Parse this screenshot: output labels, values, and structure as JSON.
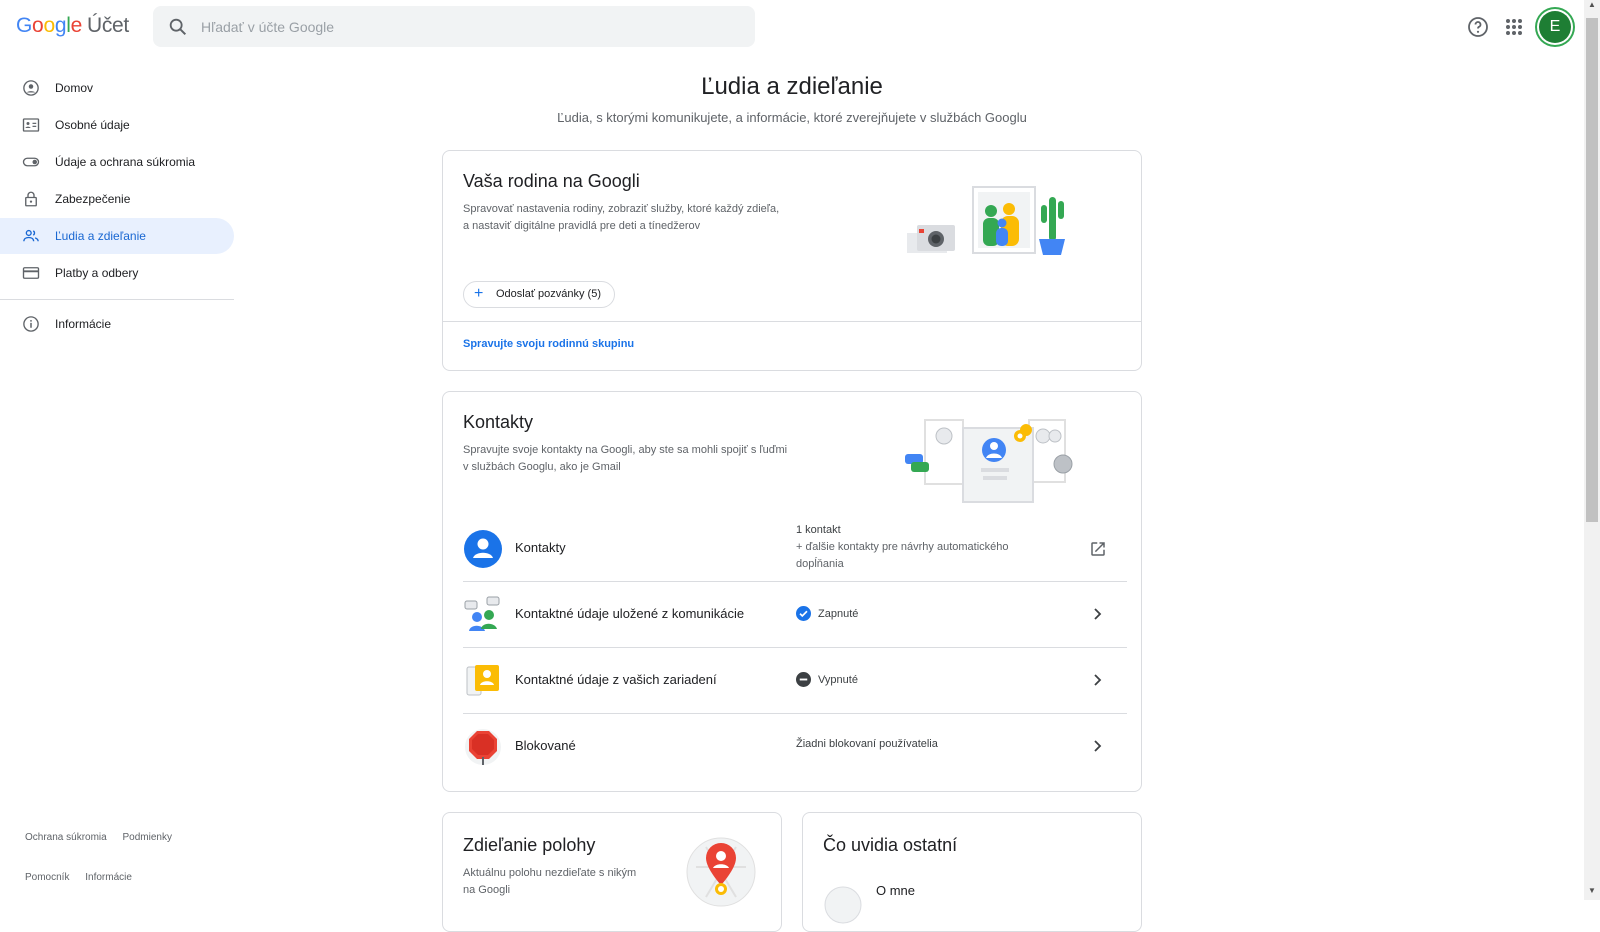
{
  "header": {
    "logo": [
      "G",
      "o",
      "o",
      "g",
      "l",
      "e"
    ],
    "account_label": "Účet",
    "search_placeholder": "Hľadať v účte Google",
    "avatar_letter": "E"
  },
  "sidebar": {
    "items": [
      {
        "label": "Domov",
        "icon": "home-person-icon"
      },
      {
        "label": "Osobné údaje",
        "icon": "id-card-icon"
      },
      {
        "label": "Údaje a ochrana súkromia",
        "icon": "toggle-icon"
      },
      {
        "label": "Zabezpečenie",
        "icon": "lock-icon"
      },
      {
        "label": "Ľudia a zdieľanie",
        "icon": "people-icon"
      },
      {
        "label": "Platby a odbery",
        "icon": "credit-card-icon"
      }
    ],
    "info_item": {
      "label": "Informácie",
      "icon": "info-icon"
    },
    "footer": [
      "Ochrana súkromia",
      "Podmienky",
      "Pomocník",
      "Informácie"
    ]
  },
  "page": {
    "title": "Ľudia a zdieľanie",
    "subtitle": "Ľudia, s ktorými komunikujete, a informácie, ktoré zverejňujete v službách Googlu"
  },
  "family_card": {
    "title": "Vaša rodina na Googli",
    "desc_line1": "Spravovať nastavenia rodiny, zobraziť služby, ktoré každý zdieľa,",
    "desc_line2": "a nastaviť digitálne pravidlá pre deti a tínedžerov",
    "invite_button": "Odoslať pozvánky (5)",
    "manage_link": "Spravujte svoju rodinnú skupinu"
  },
  "contacts_card": {
    "title": "Kontakty",
    "desc_line1": "Spravujte svoje kontakty na Googli, aby ste sa mohli spojiť s ľuďmi",
    "desc_line2": "v službách Googlu, ako je Gmail",
    "rows": [
      {
        "label": "Kontakty",
        "status_line1": "1 kontakt",
        "status_line2": "+ ďalšie kontakty pre návrhy automatického",
        "status_line3": "dopĺňania"
      },
      {
        "label": "Kontaktné údaje uložené z komunikácie",
        "status": "Zapnuté",
        "status_icon": "check-circle-icon"
      },
      {
        "label": "Kontaktné údaje z vašich zariadení",
        "status": "Vypnuté",
        "status_icon": "minus-circle-icon"
      },
      {
        "label": "Blokované",
        "status": "Žiadni blokovaní používatelia"
      }
    ]
  },
  "location_card": {
    "title": "Zdieľanie polohy",
    "desc_line1": "Aktuálnu polohu nezdieľate s nikým",
    "desc_line2": "na Googli"
  },
  "others_card": {
    "title": "Čo uvidia ostatní",
    "row_label": "O mne"
  },
  "colors": {
    "blue": "#1a73e8",
    "active_bg": "#e8f0fe",
    "border": "#dadce0",
    "avatar_green": "#1e7e34"
  }
}
